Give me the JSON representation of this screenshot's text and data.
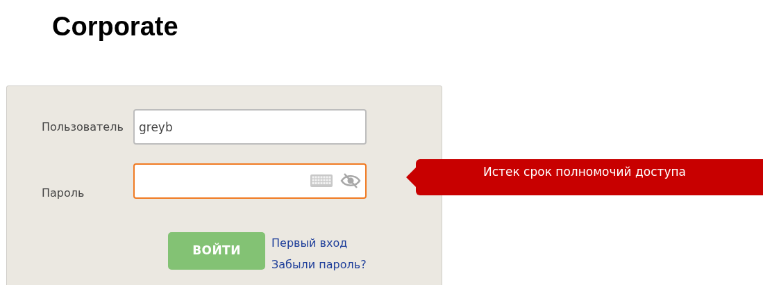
{
  "heading": "Corporate",
  "fields": [
    {
      "label": "Пользователь",
      "value": "greyb",
      "kind": "text",
      "focused": false
    },
    {
      "label": "Пароль",
      "kind": "password",
      "focused": true
    }
  ],
  "error_tooltip": "Истек срок полномочий доступа",
  "submit_button": "ВОЙТИ",
  "links": [
    "Первый вход",
    "Забыли пароль?"
  ]
}
